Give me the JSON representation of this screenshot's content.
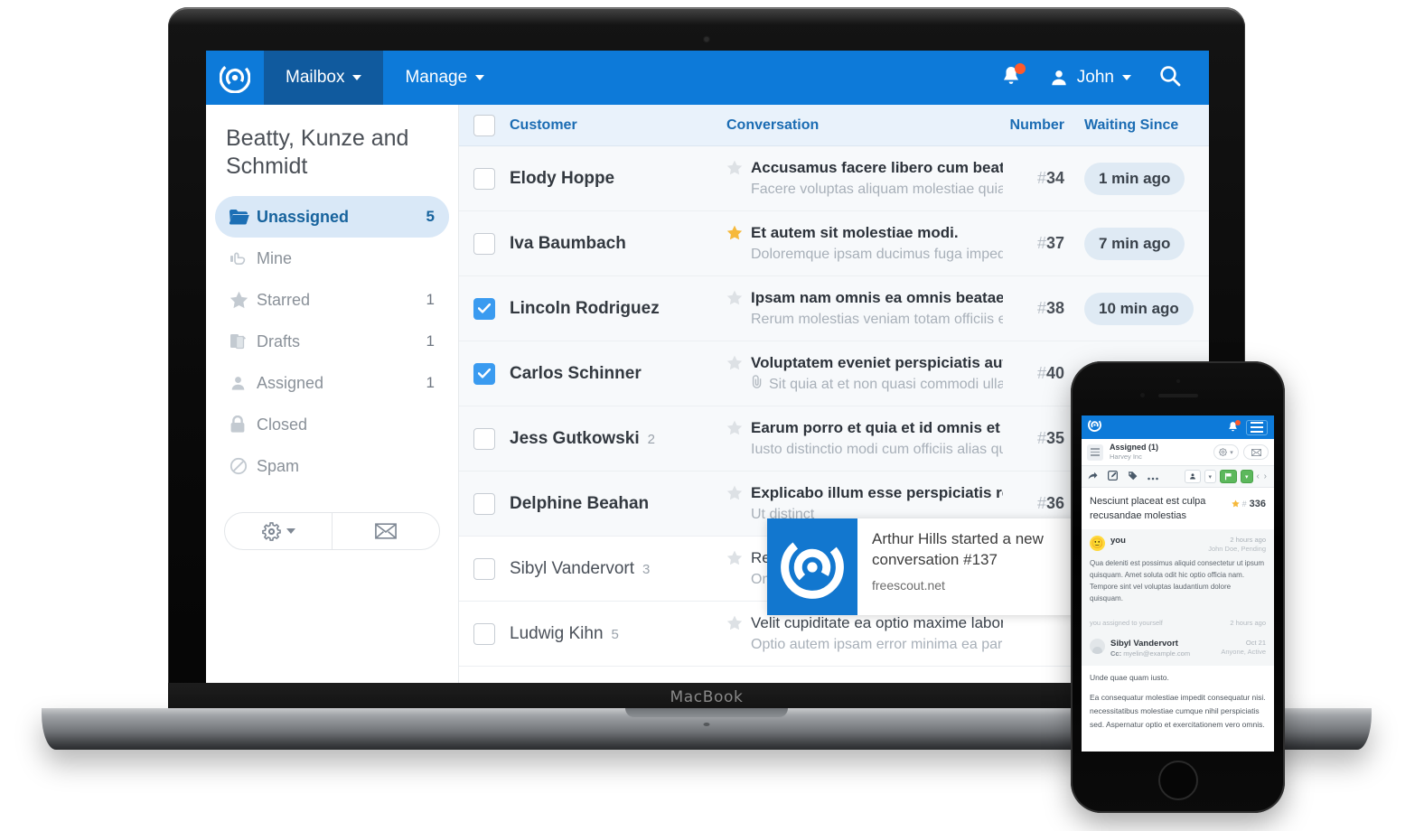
{
  "device": {
    "laptop_label": "MacBook"
  },
  "app": {
    "brand_icon": "freescout-logo-icon",
    "nav": [
      {
        "label": "Mailbox",
        "active": true
      },
      {
        "label": "Manage",
        "active": false
      }
    ],
    "header_right": {
      "bell_icon": "bell-icon",
      "has_notification": true,
      "user_icon": "user-icon",
      "user_name": "John",
      "search_icon": "search-icon"
    },
    "colors": {
      "header_blue": "#0d7ad9",
      "header_active": "#105a9e",
      "accent_blue": "#3a9bf0",
      "selected_folder_bg": "#d9e8f7",
      "selected_folder_text": "#17639d",
      "badge_orange": "#ff5a2b",
      "waiting_badge_bg": "#dfeaf4",
      "star_gold": "#f6b93b"
    }
  },
  "sidebar": {
    "mailbox_name": "Beatty, Kunze and Schmidt",
    "folders": [
      {
        "icon": "folder-open-icon",
        "label": "Unassigned",
        "count": "5",
        "selected": true
      },
      {
        "icon": "hand-pointer-icon",
        "label": "Mine",
        "count": "",
        "selected": false
      },
      {
        "icon": "star-icon",
        "label": "Starred",
        "count": "1",
        "selected": false
      },
      {
        "icon": "drafts-icon",
        "label": "Drafts",
        "count": "1",
        "selected": false
      },
      {
        "icon": "user-icon",
        "label": "Assigned",
        "count": "1",
        "selected": false
      },
      {
        "icon": "lock-icon",
        "label": "Closed",
        "count": "",
        "selected": false
      },
      {
        "icon": "ban-icon",
        "label": "Spam",
        "count": "",
        "selected": false
      }
    ],
    "actions": [
      {
        "icon": "gear-icon",
        "caret": true,
        "name": "settings-dropdown"
      },
      {
        "icon": "envelope-icon",
        "caret": false,
        "name": "new-conversation"
      }
    ]
  },
  "list": {
    "columns": {
      "customer": "Customer",
      "conversation": "Conversation",
      "number": "Number",
      "waiting_since": "Waiting Since"
    },
    "rows": [
      {
        "checked": false,
        "unread": true,
        "starred": false,
        "attachment": false,
        "customer": "Elody Hoppe",
        "threads": "",
        "subject": "Accusamus facere libero cum beatae fugit a",
        "preview": "Facere voluptas aliquam molestiae quia nisi offi",
        "number": "34",
        "waiting": "1 min ago"
      },
      {
        "checked": false,
        "unread": true,
        "starred": true,
        "attachment": false,
        "customer": "Iva Baumbach",
        "threads": "",
        "subject": "Et autem sit molestiae modi.",
        "preview": "Doloremque ipsam ducimus fuga impedit rem.",
        "number": "37",
        "waiting": "7 min ago"
      },
      {
        "checked": true,
        "unread": true,
        "starred": false,
        "attachment": false,
        "customer": "Lincoln Rodriguez",
        "threads": "",
        "subject": "Ipsam nam omnis ea omnis beatae.",
        "preview": "Rerum molestias veniam totam officiis et non.",
        "number": "38",
        "waiting": "10 min ago"
      },
      {
        "checked": true,
        "unread": true,
        "starred": false,
        "attachment": true,
        "customer": "Carlos Schinner",
        "threads": "",
        "subject": "Voluptatem eveniet perspiciatis aut illo iste",
        "preview": "Sit quia at et non quasi commodi ullam. Et peri",
        "number": "40",
        "waiting": ""
      },
      {
        "checked": false,
        "unread": true,
        "starred": false,
        "attachment": false,
        "customer": "Jess Gutkowski",
        "threads": "2",
        "subject": "Earum porro et quia et id omnis et tenetur v",
        "preview": "Iusto distinctio modi cum officiis alias qui beata",
        "number": "35",
        "waiting": ""
      },
      {
        "checked": false,
        "unread": true,
        "starred": false,
        "attachment": false,
        "customer": "Delphine Beahan",
        "threads": "",
        "subject": "Explicabo illum esse perspiciatis repellat no",
        "preview": "Ut distinct",
        "number": "36",
        "waiting": ""
      },
      {
        "checked": false,
        "unread": false,
        "starred": false,
        "attachment": false,
        "customer": "Sibyl Vandervort",
        "threads": "3",
        "subject": "Repellend",
        "preview": "Omnis quo",
        "number": "",
        "waiting": ""
      },
      {
        "checked": false,
        "unread": false,
        "starred": false,
        "attachment": false,
        "customer": "Ludwig Kihn",
        "threads": "5",
        "subject": "Velit cupiditate ea optio maxime labore error be",
        "preview": "Optio autem ipsam error minima ea pariatur iste",
        "number": "",
        "waiting": ""
      }
    ]
  },
  "toast": {
    "icon": "freescout-logo-icon",
    "title": "Arthur Hills started a new conversation #137",
    "source": "freescout.net"
  },
  "phone": {
    "nav": {
      "brand_icon": "freescout-logo-icon",
      "bell_icon": "bell-icon",
      "has_notification": true,
      "menu_icon": "hamburger-icon"
    },
    "subheader": {
      "menu_icon": "hamburger-icon",
      "title": "Assigned (1)",
      "subtitle": "Harvey Inc",
      "gear_icon": "gear-icon",
      "envelope_icon": "envelope-icon"
    },
    "toolbar": {
      "icons": [
        "forward-icon",
        "edit-icon",
        "tag-icon",
        "ellipsis-icon"
      ],
      "assignee_icon": "user-icon",
      "status_icon": "flag-icon",
      "prev_next": "‹ ›"
    },
    "conversation": {
      "subject": "Nesciunt placeat est culpa recusandae molestias",
      "star_icon": "star-icon",
      "number": "336",
      "hash": "#"
    },
    "messages": [
      {
        "avatar": "smiley-avatar",
        "from": "you",
        "cc": "",
        "when": "2 hours ago",
        "meta": "John Doe, Pending",
        "body": "Qua deleniti est possimus aliquid consectetur ut ipsum quisquam. Amet soluta odit hic optio officia nam. Tempore sint vel voluptas laudantium dolore quisquam."
      }
    ],
    "separator": {
      "text": "you assigned to yourself",
      "when": "2 hours ago"
    },
    "reply": {
      "avatar": "user-avatar",
      "from": "Sibyl Vandervort",
      "cc_label": "Cc:",
      "cc_value": "myelin@example.com",
      "when": "Oct 21",
      "meta": "Anyone, Active",
      "paragraphs": [
        "Unde quae quam iusto.",
        "Ea consequatur molestiae impedit consequatur nisi. necessitatibus molestiae cumque nihil perspiciatis sed. Aspernatur optio et exercitationem vero omnis."
      ]
    }
  }
}
